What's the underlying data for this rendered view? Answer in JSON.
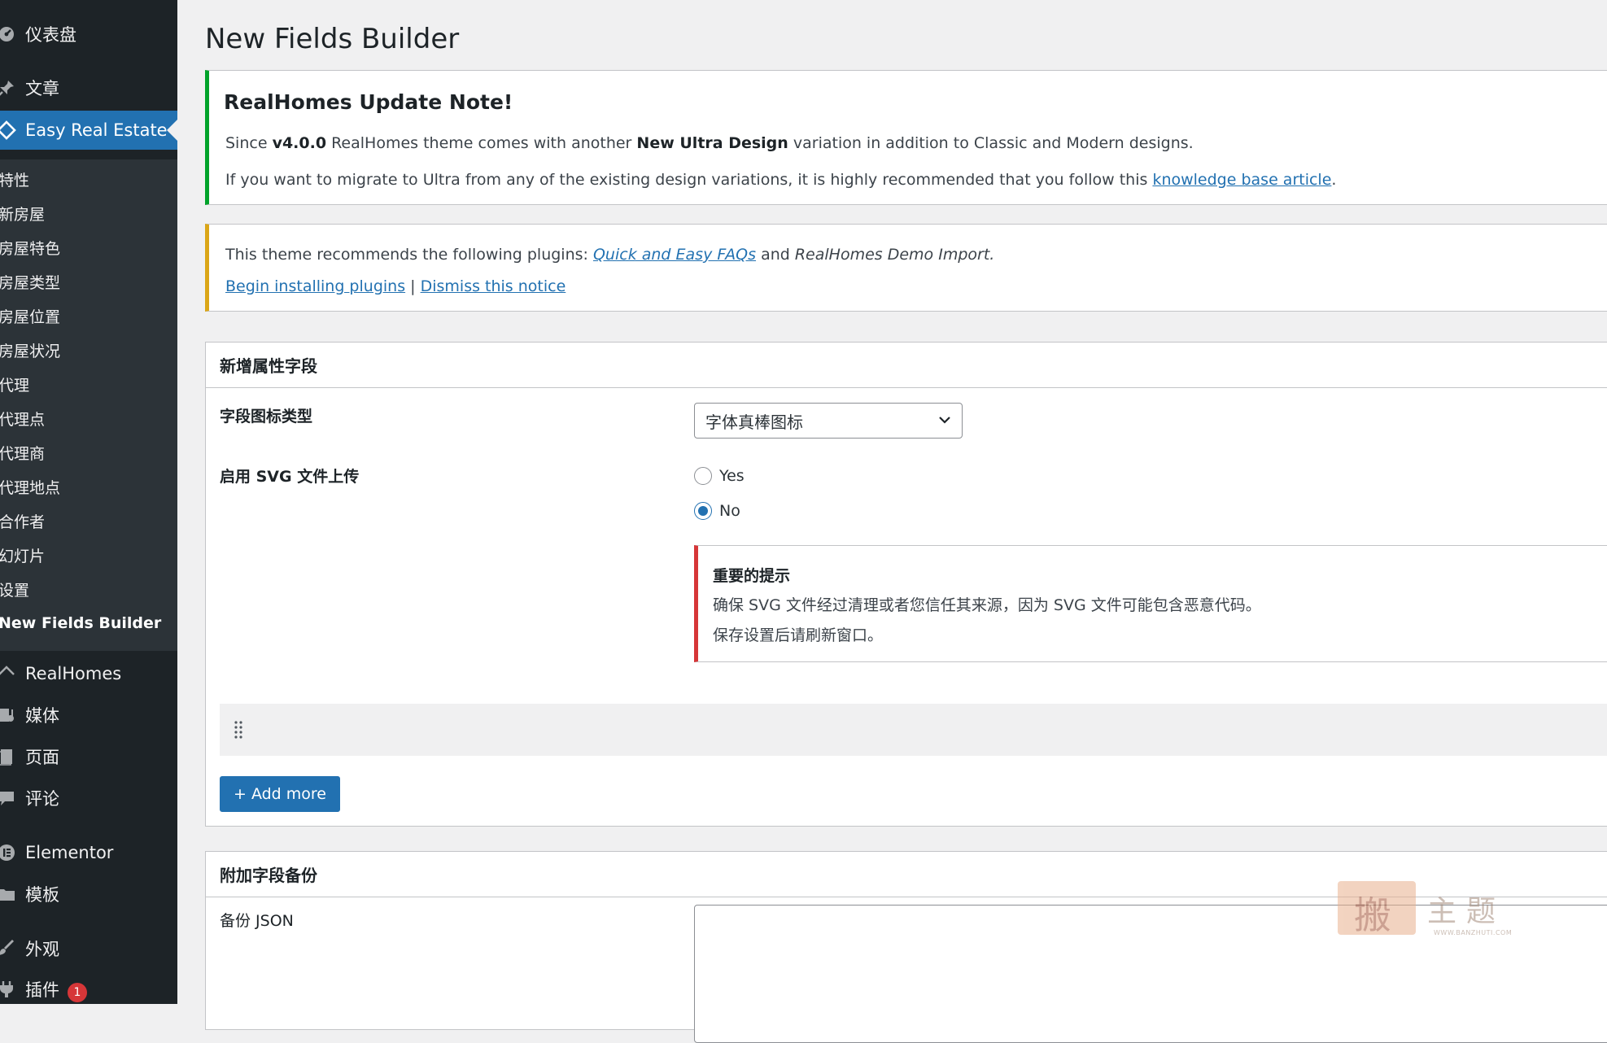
{
  "sidebar": {
    "top_items": [
      {
        "label": "仪表盘",
        "icon": "dashboard-icon"
      },
      {
        "label": "文章",
        "icon": "pushpin-icon"
      },
      {
        "label": "Easy Real Estate",
        "icon": "real-estate-icon"
      }
    ],
    "submenu": [
      {
        "label": "特性"
      },
      {
        "label": "新房屋"
      },
      {
        "label": "房屋特色"
      },
      {
        "label": "房屋类型"
      },
      {
        "label": "房屋位置"
      },
      {
        "label": "房屋状况"
      },
      {
        "label": "代理"
      },
      {
        "label": "代理点"
      },
      {
        "label": "代理商"
      },
      {
        "label": "代理地点"
      },
      {
        "label": "合作者"
      },
      {
        "label": "幻灯片"
      },
      {
        "label": "设置"
      },
      {
        "label": "New Fields Builder"
      }
    ],
    "bottom_items": [
      {
        "label": "RealHomes",
        "icon": "house-icon"
      },
      {
        "label": "媒体",
        "icon": "media-icon"
      },
      {
        "label": "页面",
        "icon": "page-icon"
      },
      {
        "label": "评论",
        "icon": "comment-icon"
      },
      {
        "label": "Elementor",
        "icon": "elementor-icon"
      },
      {
        "label": "模板",
        "icon": "folder-icon"
      },
      {
        "label": "外观",
        "icon": "brush-icon"
      },
      {
        "label": "插件",
        "icon": "plugin-icon",
        "badge": "1"
      }
    ],
    "colors": {
      "background": "#1d2327",
      "submenu": "#2c3338",
      "active": "#2271b1"
    }
  },
  "page": {
    "title": "New Fields Builder"
  },
  "notice_update": {
    "title": "RealHomes Update Note!",
    "line1_pre": "Since ",
    "line1_version": "v4.0.0",
    "line1_mid": " RealHomes theme comes with another ",
    "line1_design": "New Ultra Design",
    "line1_post": " variation in addition to Classic and Modern designs.",
    "line2_pre": "If you want to migrate to Ultra from any of the existing design variations, it is highly recommended that you follow this ",
    "line2_link": "knowledge base article",
    "line2_post": "."
  },
  "notice_plugins": {
    "line1_pre": "This theme recommends the following plugins: ",
    "plugin1": "Quick and Easy FAQs",
    "and": " and ",
    "plugin2": "RealHomes Demo Import",
    "period": ".",
    "begin_link": "Begin installing plugins",
    "separator": " | ",
    "dismiss_link": "Dismiss this notice"
  },
  "fields_box": {
    "title": "新增属性字段",
    "icon_type_label": "字段图标类型",
    "icon_type_value": "字体真棒图标",
    "svg_label": "启用 SVG 文件上传",
    "radio_options": [
      {
        "label": "Yes",
        "checked": false
      },
      {
        "label": "No",
        "checked": true
      }
    ],
    "important": {
      "title": "重要的提示",
      "line1": "确保 SVG 文件经过清理或者您信任其来源，因为 SVG 文件可能包含恶意代码。",
      "line2": "保存设置后请刷新窗口。"
    },
    "add_more": "+ Add more"
  },
  "backup_box": {
    "title": "附加字段备份",
    "json_label": "备份 JSON"
  },
  "watermark": {
    "char": "搬",
    "text": "主题",
    "url": "WWW.BANZHUTI.COM"
  }
}
